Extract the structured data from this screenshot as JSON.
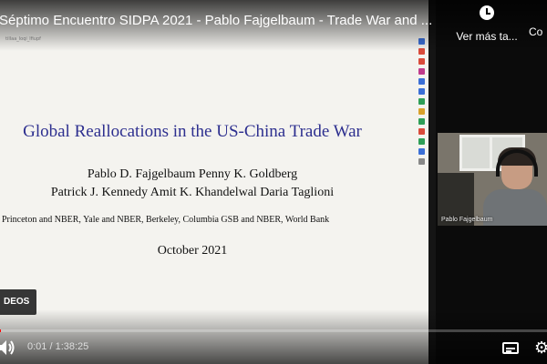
{
  "video": {
    "title": "Séptimo Encuentro SIDPA 2021 - Pablo Fajgelbaum - Trade War and ...",
    "watch_later_label": "Ver más ta...",
    "share_label": "Co",
    "videos_pill_label": "DEOS",
    "time_display": "0:01 / 1:38:25",
    "progress_fraction": 0.001
  },
  "slide": {
    "file_label": "tillaa_loqi_lfiupf",
    "title": "Global Reallocations in the US-China Trade War",
    "authors_line1": "Pablo D. Fajgelbaum    Penny K. Goldberg",
    "authors_line2": "Patrick J. Kennedy    Amit K. Khandelwal    Daria Taglioni",
    "affiliations": "Princeton and NBER, Yale and NBER, Berkeley, Columbia GSB and NBER, World Bank",
    "date": "October 2021",
    "tool_colors": [
      "#3b6fd6",
      "#d94b3b",
      "#d94b3b",
      "#c03b8c",
      "#3b6fd6",
      "#3b6fd6",
      "#2e9e57",
      "#d9a12b",
      "#2e9e57",
      "#d94b3b",
      "#2e9e57",
      "#3b6fd6",
      "#888888"
    ]
  },
  "webcam": {
    "name_label": "Pablo Fajgelbaum"
  },
  "icons": {
    "clock": "clock-icon",
    "volume": "volume-icon",
    "subtitles": "subtitles-icon",
    "settings": "gear-icon"
  }
}
